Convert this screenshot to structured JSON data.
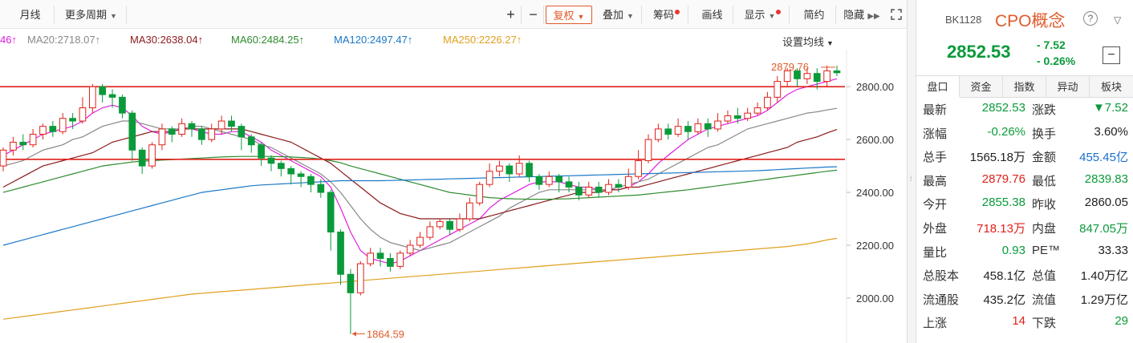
{
  "toolbar": {
    "yuexian": "月线",
    "more_periods": "更多周期",
    "plus": "+",
    "minus": "−",
    "fuquan": "复权",
    "diejia": "叠加",
    "chouma": "筹码",
    "huaxian": "画线",
    "xianshi": "显示",
    "jianyue": "简约",
    "yincang": "隐藏",
    "expand_icon": "expand-icon"
  },
  "ma_legend": {
    "ma10_partial": "46",
    "ma20": "MA20:2718.07",
    "ma30": "MA30:2638.04",
    "ma60": "MA60:2484.25",
    "ma120": "MA120:2497.47",
    "ma250": "MA250:2226.27",
    "arrow": "↑",
    "settings": "设置均线",
    "colors": {
      "ma10": "#e020e0",
      "ma20": "#888888",
      "ma30": "#8b1a1a",
      "ma60": "#2e8b2e",
      "ma120": "#1a78c8",
      "ma250": "#e0a020"
    }
  },
  "chart_data": {
    "type": "candlestick",
    "y_ticks": [
      "2800.00",
      "2600.00",
      "2400.00",
      "2200.00",
      "2000.00"
    ],
    "y_tick_values": [
      2800,
      2600,
      2400,
      2200,
      2000
    ],
    "ylim": [
      1830,
      2940
    ],
    "high_label": "2879.76",
    "low_label": "1864.59",
    "high_value": 2879.76,
    "low_value": 1864.59,
    "support_lines": [
      2800,
      2525
    ],
    "up_color": "#e0211a",
    "down_color": "#0a9a3a",
    "candles": [
      [
        2500,
        2560,
        2480,
        2570
      ],
      [
        2560,
        2590,
        2540,
        2610
      ],
      [
        2590,
        2580,
        2560,
        2620
      ],
      [
        2580,
        2620,
        2570,
        2640
      ],
      [
        2620,
        2650,
        2600,
        2660
      ],
      [
        2650,
        2630,
        2610,
        2670
      ],
      [
        2630,
        2680,
        2620,
        2700
      ],
      [
        2680,
        2670,
        2640,
        2700
      ],
      [
        2670,
        2720,
        2660,
        2760
      ],
      [
        2720,
        2800,
        2700,
        2810
      ],
      [
        2800,
        2770,
        2740,
        2810
      ],
      [
        2770,
        2760,
        2720,
        2790
      ],
      [
        2760,
        2700,
        2680,
        2770
      ],
      [
        2700,
        2560,
        2520,
        2710
      ],
      [
        2560,
        2500,
        2470,
        2570
      ],
      [
        2500,
        2580,
        2490,
        2590
      ],
      [
        2580,
        2640,
        2560,
        2660
      ],
      [
        2640,
        2620,
        2590,
        2650
      ],
      [
        2620,
        2660,
        2610,
        2680
      ],
      [
        2660,
        2640,
        2610,
        2670
      ],
      [
        2640,
        2600,
        2580,
        2650
      ],
      [
        2600,
        2640,
        2590,
        2660
      ],
      [
        2640,
        2670,
        2620,
        2690
      ],
      [
        2670,
        2650,
        2630,
        2690
      ],
      [
        2650,
        2610,
        2560,
        2660
      ],
      [
        2610,
        2580,
        2550,
        2620
      ],
      [
        2580,
        2530,
        2500,
        2590
      ],
      [
        2530,
        2510,
        2480,
        2540
      ],
      [
        2510,
        2490,
        2460,
        2520
      ],
      [
        2490,
        2470,
        2430,
        2500
      ],
      [
        2470,
        2460,
        2420,
        2480
      ],
      [
        2460,
        2430,
        2400,
        2470
      ],
      [
        2430,
        2400,
        2380,
        2450
      ],
      [
        2400,
        2250,
        2180,
        2410
      ],
      [
        2250,
        2090,
        2050,
        2260
      ],
      [
        2090,
        2020,
        1864,
        2110
      ],
      [
        2020,
        2130,
        2010,
        2140
      ],
      [
        2130,
        2170,
        2120,
        2190
      ],
      [
        2170,
        2150,
        2120,
        2190
      ],
      [
        2150,
        2120,
        2100,
        2170
      ],
      [
        2120,
        2170,
        2110,
        2180
      ],
      [
        2170,
        2200,
        2160,
        2220
      ],
      [
        2200,
        2230,
        2190,
        2250
      ],
      [
        2230,
        2270,
        2220,
        2290
      ],
      [
        2270,
        2290,
        2260,
        2300
      ],
      [
        2290,
        2260,
        2240,
        2300
      ],
      [
        2260,
        2300,
        2250,
        2320
      ],
      [
        2300,
        2360,
        2290,
        2380
      ],
      [
        2360,
        2430,
        2350,
        2440
      ],
      [
        2430,
        2480,
        2420,
        2510
      ],
      [
        2480,
        2500,
        2460,
        2520
      ],
      [
        2500,
        2470,
        2440,
        2510
      ],
      [
        2470,
        2510,
        2460,
        2540
      ],
      [
        2510,
        2460,
        2440,
        2520
      ],
      [
        2460,
        2430,
        2410,
        2470
      ],
      [
        2430,
        2460,
        2420,
        2480
      ],
      [
        2460,
        2440,
        2400,
        2470
      ],
      [
        2440,
        2420,
        2400,
        2460
      ],
      [
        2420,
        2390,
        2370,
        2440
      ],
      [
        2390,
        2420,
        2380,
        2440
      ],
      [
        2420,
        2400,
        2380,
        2440
      ],
      [
        2400,
        2430,
        2390,
        2450
      ],
      [
        2430,
        2420,
        2400,
        2450
      ],
      [
        2420,
        2460,
        2410,
        2490
      ],
      [
        2460,
        2520,
        2450,
        2560
      ],
      [
        2520,
        2600,
        2510,
        2620
      ],
      [
        2600,
        2640,
        2590,
        2660
      ],
      [
        2640,
        2620,
        2600,
        2660
      ],
      [
        2620,
        2650,
        2610,
        2680
      ],
      [
        2650,
        2630,
        2600,
        2670
      ],
      [
        2630,
        2660,
        2620,
        2680
      ],
      [
        2660,
        2640,
        2610,
        2680
      ],
      [
        2640,
        2670,
        2630,
        2700
      ],
      [
        2670,
        2690,
        2660,
        2710
      ],
      [
        2690,
        2680,
        2660,
        2720
      ],
      [
        2680,
        2700,
        2670,
        2720
      ],
      [
        2700,
        2720,
        2690,
        2740
      ],
      [
        2720,
        2760,
        2710,
        2780
      ],
      [
        2760,
        2820,
        2740,
        2840
      ],
      [
        2820,
        2860,
        2800,
        2870
      ],
      [
        2860,
        2830,
        2800,
        2870
      ],
      [
        2830,
        2850,
        2810,
        2870
      ],
      [
        2850,
        2820,
        2790,
        2870
      ],
      [
        2820,
        2860,
        2800,
        2880
      ],
      [
        2860,
        2852.53,
        2839.83,
        2879.76
      ]
    ],
    "ma_series": {
      "ma10": [
        2540,
        2560,
        2580,
        2600,
        2620,
        2630,
        2640,
        2650,
        2670,
        2700,
        2720,
        2730,
        2720,
        2690,
        2650,
        2630,
        2620,
        2630,
        2640,
        2640,
        2630,
        2620,
        2620,
        2630,
        2630,
        2610,
        2590,
        2560,
        2540,
        2520,
        2500,
        2480,
        2460,
        2420,
        2340,
        2250,
        2180,
        2150,
        2140,
        2130,
        2140,
        2160,
        2180,
        2200,
        2220,
        2240,
        2260,
        2280,
        2300,
        2340,
        2370,
        2390,
        2410,
        2430,
        2440,
        2440,
        2440,
        2430,
        2420,
        2420,
        2410,
        2410,
        2410,
        2420,
        2440,
        2470,
        2510,
        2540,
        2570,
        2600,
        2620,
        2640,
        2650,
        2660,
        2670,
        2680,
        2690,
        2710,
        2740,
        2770,
        2790,
        2800,
        2810,
        2820,
        2830
      ],
      "ma20": [
        2500,
        2510,
        2520,
        2540,
        2560,
        2570,
        2580,
        2600,
        2610,
        2630,
        2650,
        2660,
        2670,
        2670,
        2660,
        2650,
        2640,
        2640,
        2640,
        2650,
        2650,
        2640,
        2630,
        2620,
        2610,
        2600,
        2580,
        2570,
        2550,
        2530,
        2510,
        2490,
        2470,
        2440,
        2400,
        2350,
        2300,
        2260,
        2230,
        2210,
        2200,
        2190,
        2180,
        2190,
        2200,
        2210,
        2230,
        2250,
        2270,
        2290,
        2310,
        2340,
        2360,
        2380,
        2400,
        2410,
        2410,
        2410,
        2410,
        2410,
        2410,
        2410,
        2420,
        2430,
        2440,
        2450,
        2470,
        2490,
        2510,
        2530,
        2550,
        2570,
        2580,
        2600,
        2620,
        2640,
        2650,
        2660,
        2670,
        2680,
        2690,
        2700,
        2705,
        2712,
        2718
      ],
      "ma30": [
        2420,
        2440,
        2460,
        2480,
        2500,
        2510,
        2520,
        2530,
        2540,
        2550,
        2570,
        2590,
        2600,
        2610,
        2620,
        2630,
        2630,
        2630,
        2640,
        2640,
        2640,
        2640,
        2640,
        2640,
        2640,
        2630,
        2620,
        2610,
        2600,
        2590,
        2570,
        2550,
        2530,
        2510,
        2480,
        2450,
        2420,
        2390,
        2360,
        2340,
        2320,
        2310,
        2300,
        2300,
        2300,
        2300,
        2300,
        2300,
        2300,
        2310,
        2320,
        2330,
        2340,
        2350,
        2360,
        2370,
        2380,
        2390,
        2400,
        2400,
        2400,
        2410,
        2410,
        2420,
        2420,
        2430,
        2440,
        2450,
        2460,
        2470,
        2480,
        2490,
        2500,
        2510,
        2520,
        2530,
        2540,
        2550,
        2560,
        2570,
        2590,
        2600,
        2610,
        2625,
        2638
      ],
      "ma60": [
        2400,
        2410,
        2420,
        2430,
        2440,
        2450,
        2460,
        2470,
        2480,
        2490,
        2500,
        2505,
        2510,
        2515,
        2518,
        2520,
        2522,
        2524,
        2526,
        2528,
        2530,
        2532,
        2534,
        2535,
        2536,
        2536,
        2536,
        2536,
        2535,
        2534,
        2532,
        2530,
        2526,
        2520,
        2512,
        2500,
        2490,
        2480,
        2470,
        2460,
        2450,
        2440,
        2430,
        2420,
        2410,
        2400,
        2395,
        2390,
        2385,
        2380,
        2378,
        2376,
        2375,
        2374,
        2374,
        2374,
        2375,
        2376,
        2378,
        2380,
        2382,
        2384,
        2386,
        2388,
        2390,
        2394,
        2398,
        2402,
        2406,
        2410,
        2415,
        2420,
        2425,
        2430,
        2435,
        2440,
        2445,
        2450,
        2455,
        2460,
        2465,
        2470,
        2475,
        2480,
        2484
      ],
      "ma120": [
        2200,
        2210,
        2220,
        2230,
        2240,
        2250,
        2260,
        2270,
        2280,
        2290,
        2300,
        2310,
        2320,
        2330,
        2340,
        2350,
        2360,
        2370,
        2380,
        2390,
        2400,
        2405,
        2410,
        2415,
        2420,
        2425,
        2428,
        2430,
        2432,
        2434,
        2436,
        2438,
        2440,
        2442,
        2444,
        2444,
        2444,
        2444,
        2444,
        2445,
        2446,
        2447,
        2448,
        2449,
        2450,
        2451,
        2452,
        2453,
        2454,
        2455,
        2456,
        2457,
        2458,
        2459,
        2460,
        2461,
        2462,
        2463,
        2464,
        2465,
        2466,
        2467,
        2468,
        2469,
        2470,
        2471,
        2472,
        2473,
        2474,
        2475,
        2476,
        2477,
        2478,
        2479,
        2480,
        2481,
        2482,
        2484,
        2486,
        2488,
        2490,
        2492,
        2494,
        2496,
        2497
      ],
      "ma250": [
        1920,
        1925,
        1930,
        1935,
        1940,
        1945,
        1950,
        1955,
        1960,
        1965,
        1970,
        1975,
        1980,
        1985,
        1990,
        1995,
        2000,
        2005,
        2010,
        2015,
        2018,
        2021,
        2024,
        2027,
        2030,
        2033,
        2036,
        2039,
        2042,
        2045,
        2048,
        2051,
        2054,
        2057,
        2060,
        2063,
        2066,
        2069,
        2072,
        2075,
        2078,
        2081,
        2084,
        2087,
        2090,
        2093,
        2096,
        2099,
        2102,
        2105,
        2108,
        2111,
        2114,
        2117,
        2120,
        2123,
        2126,
        2129,
        2132,
        2135,
        2138,
        2141,
        2144,
        2147,
        2150,
        2153,
        2156,
        2159,
        2162,
        2165,
        2168,
        2171,
        2174,
        2177,
        2180,
        2183,
        2186,
        2189,
        2192,
        2195,
        2200,
        2205,
        2212,
        2220,
        2226
      ]
    }
  },
  "quote": {
    "code": "BK1128",
    "name": "CPO概念",
    "help_icon": "?",
    "collapse_icon": "▽",
    "price": "2852.53",
    "change": "- 7.52",
    "change_pct": "- 0.26%",
    "minus_btn": "−",
    "tabs": [
      "盘口",
      "资金",
      "指数",
      "异动",
      "板块"
    ],
    "rows": [
      {
        "l1": "最新",
        "v1": "2852.53",
        "c1": "green",
        "l2": "涨跌",
        "v2": "▼7.52",
        "c2": "green"
      },
      {
        "l1": "涨幅",
        "v1": "-0.26%",
        "c1": "green",
        "l2": "换手",
        "v2": "3.60%",
        "c2": "dark"
      },
      {
        "l1": "总手",
        "v1": "1565.18万",
        "c1": "dark",
        "l2": "金额",
        "v2": "455.45亿",
        "c2": "blue"
      },
      {
        "l1": "最高",
        "v1": "2879.76",
        "c1": "red",
        "l2": "最低",
        "v2": "2839.83",
        "c2": "green"
      },
      {
        "l1": "今开",
        "v1": "2855.38",
        "c1": "green",
        "l2": "昨收",
        "v2": "2860.05",
        "c2": "dark"
      },
      {
        "l1": "外盘",
        "v1": "718.13万",
        "c1": "red",
        "l2": "内盘",
        "v2": "847.05万",
        "c2": "green"
      },
      {
        "l1": "量比",
        "v1": "0.93",
        "c1": "green",
        "l2": "PE™",
        "v2": "33.33",
        "c2": "dark"
      },
      {
        "l1": "总股本",
        "v1": "458.1亿",
        "c1": "dark",
        "l2": "总值",
        "v2": "1.40万亿",
        "c2": "dark"
      },
      {
        "l1": "流通股",
        "v1": "435.2亿",
        "c1": "dark",
        "l2": "流值",
        "v2": "1.29万亿",
        "c2": "dark"
      },
      {
        "l1": "上涨",
        "v1": "14",
        "c1": "red",
        "l2": "下跌",
        "v2": "29",
        "c2": "green"
      }
    ]
  }
}
